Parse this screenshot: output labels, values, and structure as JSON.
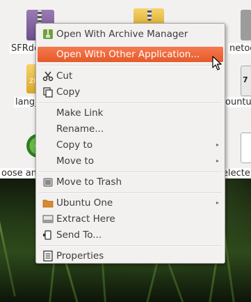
{
  "desktop": {
    "icons": [
      {
        "name": "archive-file-icon",
        "label": "SFRde"
      },
      {
        "name": "zip-file-icon",
        "label": "lang_"
      },
      {
        "name": "disc-icon",
        "label": "oose and"
      },
      {
        "name": "ubuntu-archive-icon",
        "label": "netoo"
      },
      {
        "name": "sevenzip-file-icon",
        "label": "ountu"
      },
      {
        "name": "text-file-icon",
        "label": "electe"
      }
    ]
  },
  "menu": {
    "items": [
      {
        "label": "Open With Archive Manager",
        "icon": "archive-manager-icon"
      },
      {
        "label": "Open With Other Application...",
        "icon": "",
        "highlighted": true
      },
      {
        "label": "Cut",
        "icon": "scissors-icon"
      },
      {
        "label": "Copy",
        "icon": "copy-icon"
      },
      {
        "label": "Make Link",
        "icon": ""
      },
      {
        "label": "Rename...",
        "icon": ""
      },
      {
        "label": "Copy to",
        "icon": "",
        "submenu": true
      },
      {
        "label": "Move to",
        "icon": "",
        "submenu": true
      },
      {
        "label": "Move to Trash",
        "icon": "trash-icon"
      },
      {
        "label": "Ubuntu One",
        "icon": "folder-icon",
        "submenu": true
      },
      {
        "label": "Extract Here",
        "icon": "extract-icon"
      },
      {
        "label": "Send To...",
        "icon": "send-to-icon"
      },
      {
        "label": "Properties",
        "icon": "properties-icon"
      }
    ],
    "submenu_arrow": "▸"
  },
  "colors": {
    "highlight": "#e65a2a",
    "menu_bg": "#f2f1f0"
  }
}
